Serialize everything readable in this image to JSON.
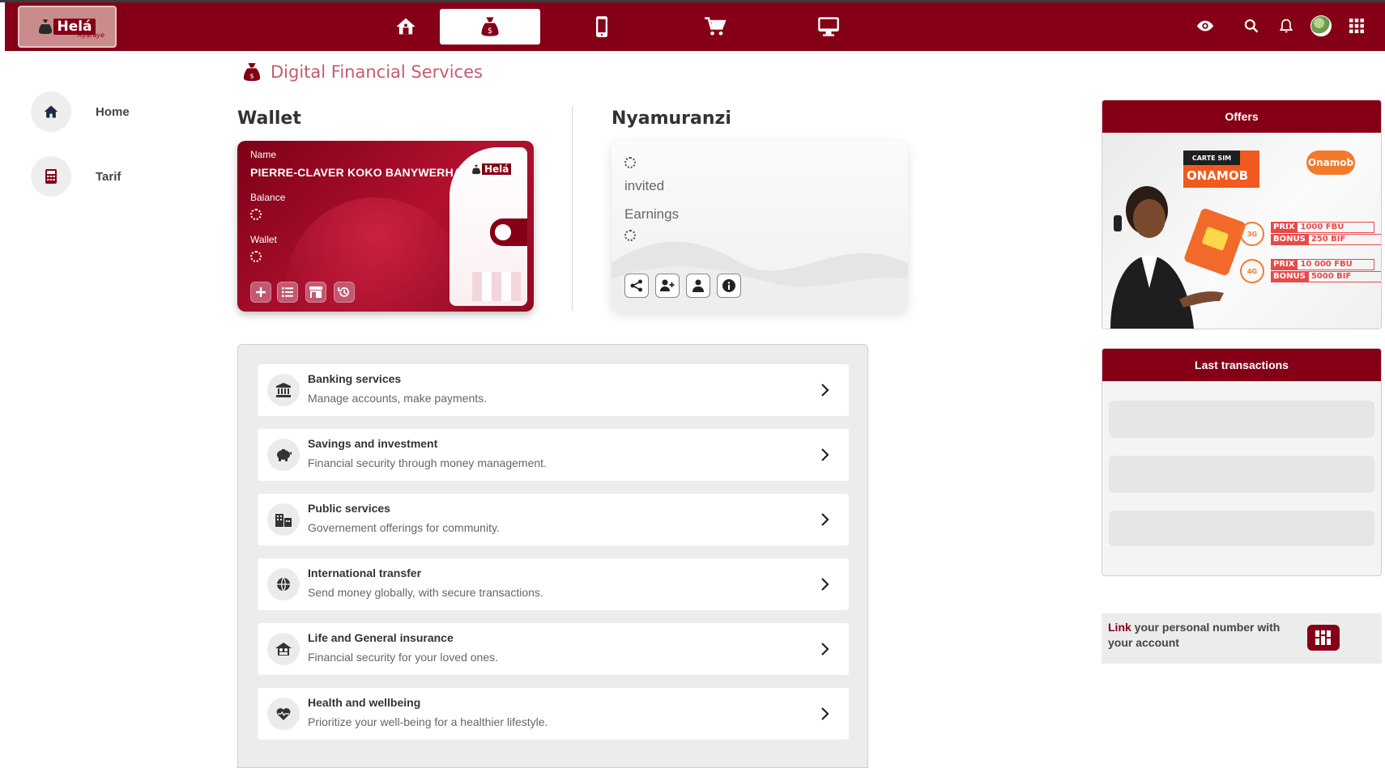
{
  "brand": {
    "logo_text": "Helá",
    "logo_sub": "Ryaraye",
    "primary_color": "#850016",
    "accent_color": "#c45c6e"
  },
  "navbar": {
    "items": [
      {
        "icon": "home-icon",
        "active": false
      },
      {
        "icon": "money-bag-icon",
        "active": true
      },
      {
        "icon": "mobile-icon",
        "active": false
      },
      {
        "icon": "cart-icon",
        "active": false
      },
      {
        "icon": "desktop-icon",
        "active": false
      }
    ],
    "right": [
      "eye-icon",
      "search-icon",
      "bell-icon",
      "avatar",
      "apps-grid-icon"
    ]
  },
  "sidebar": {
    "items": [
      {
        "label": "Home",
        "icon": "home-icon"
      },
      {
        "label": "Tarif",
        "icon": "calculator-icon"
      }
    ]
  },
  "page": {
    "title": "Digital Financial Services"
  },
  "wallet": {
    "heading": "Wallet",
    "name_label": "Name",
    "name_value": "PIERRE-CLAVER KOKO BANYWERHA",
    "balance_label": "Balance",
    "wallet_label": "Wallet",
    "actions": [
      "add-icon",
      "list-icon",
      "store-icon",
      "history-icon"
    ]
  },
  "referral": {
    "heading": "Nyamuranzi",
    "invited_label": "invited",
    "earnings_label": "Earnings",
    "actions": [
      "share-icon",
      "add-user-icon",
      "user-icon",
      "info-icon"
    ]
  },
  "services": [
    {
      "title": "Banking services",
      "desc": "Manage accounts, make payments.",
      "icon": "bank-icon"
    },
    {
      "title": "Savings and investment",
      "desc": "Financial security through money management.",
      "icon": "piggy-bank-icon"
    },
    {
      "title": "Public services",
      "desc": "Governement offerings for community.",
      "icon": "buildings-icon"
    },
    {
      "title": "International transfer",
      "desc": "Send money globally, with secure transactions.",
      "icon": "globe-icon"
    },
    {
      "title": "Life and General insurance",
      "desc": "Financial security for your loved ones.",
      "icon": "insurance-icon"
    },
    {
      "title": "Health and wellbeing",
      "desc": "Prioritize your well-being for a healthier lifestyle.",
      "icon": "heart-pulse-icon"
    }
  ],
  "offers": {
    "heading": "Offers",
    "badge_top": "CARTE SIM",
    "badge_main": "ONAMOB",
    "brand": "Onamob",
    "rows": [
      {
        "net": "3G",
        "prix_label": "PRIX",
        "prix": "1000 FBU",
        "bonus_label": "BONUS",
        "bonus": "250 BIF"
      },
      {
        "net": "4G",
        "prix_label": "PRIX",
        "prix": "10 000 FBU",
        "bonus_label": "BONUS",
        "bonus": "5000 BIF"
      }
    ]
  },
  "transactions": {
    "heading": "Last transactions"
  },
  "link_number": {
    "highlight": "Link",
    "text": " your personal number with your account"
  }
}
